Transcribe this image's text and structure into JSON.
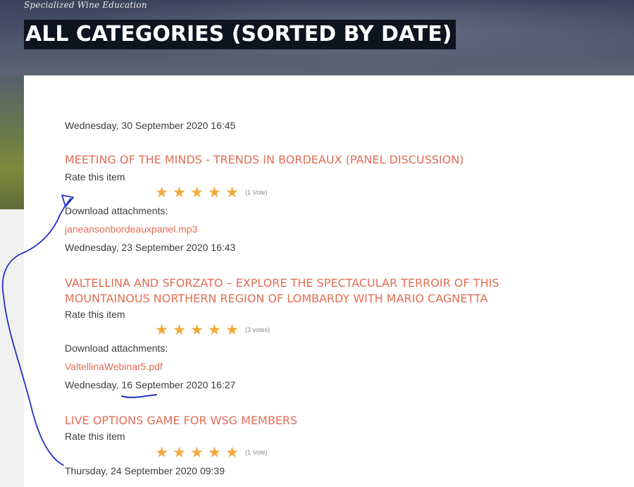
{
  "header": {
    "tagline": "Specialized Wine Education",
    "title": "ALL CATEGORIES (SORTED BY DATE)"
  },
  "colors": {
    "accent": "#e26d55",
    "star": "#f2a93b",
    "title_bg": "#0e1320",
    "annotation_ink": "#2430c9"
  },
  "items": [
    {
      "date": "Wednesday, 30 September 2020 16:45",
      "title": "MEETING OF THE MINDS - TRENDS IN BORDEAUX (PANEL DISCUSSION)",
      "rate_label": "Rate this item",
      "votes": "(1 Vote)",
      "download_label": "Download attachments:",
      "attachment": "janeansonbordeauxpanel.mp3"
    },
    {
      "date": "Wednesday, 23 September 2020 16:43",
      "title_line1": "VALTELLINA AND SFORZATO – EXPLORE THE SPECTACULAR TERROIR OF THIS",
      "title_line2": "MOUNTAINOUS NORTHERN REGION OF LOMBARDY WITH MARIO CAGNETTA",
      "rate_label": "Rate this item",
      "votes": "(3 votes)",
      "download_label": "Download attachments:",
      "attachment": "ValtellinaWebinar5.pdf"
    },
    {
      "date": "Wednesday, 16 September 2020 16:27",
      "title": "LIVE OPTIONS GAME FOR WSG MEMBERS",
      "rate_label": "Rate this item",
      "votes": "(1 Vote)"
    },
    {
      "date": "Thursday, 24 September 2020 09:39"
    }
  ]
}
